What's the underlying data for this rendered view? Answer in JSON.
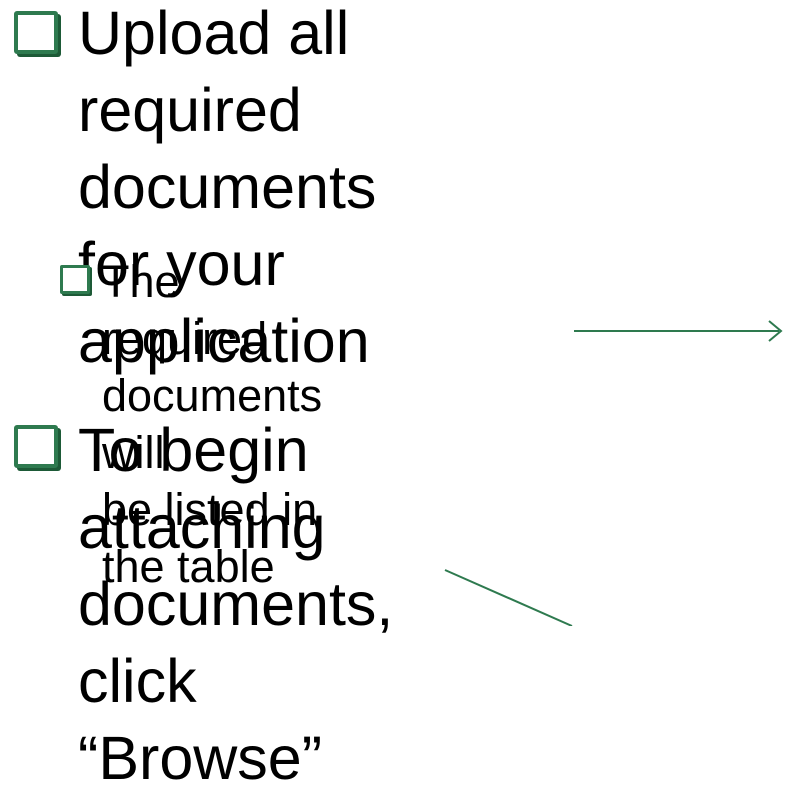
{
  "bullets": [
    {
      "level": 1,
      "text": "Upload all required\ndocuments for your\napplication"
    },
    {
      "level": 2,
      "text": "The required documents will\nbe listed in the table"
    },
    {
      "level": 1,
      "text": "To begin attaching\ndocuments, click\n“Browse”"
    }
  ],
  "colors": {
    "bullet": "#2e7a4f",
    "arrow": "#2e7a4f",
    "text": "#000000"
  },
  "icons": {
    "bullet": "checkbox-icon",
    "pointer": "arrow-icon"
  }
}
